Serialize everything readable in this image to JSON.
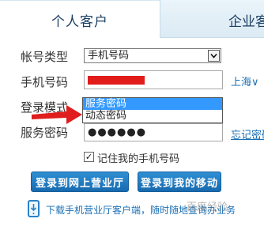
{
  "tabs": {
    "personal": "个人客户",
    "enterprise": "企业客"
  },
  "form": {
    "account_type_label": "帐号类型",
    "account_type_value": "手机号码",
    "phone_label": "手机号码",
    "region_link": "上海∨",
    "login_mode_label": "登录模式",
    "password_label": "服务密码",
    "password_mask": "●●●●●●",
    "forgot_link": "忘记密码",
    "remember_label": "记住我的手机号码",
    "remember_checked": "✓"
  },
  "login_mode_dropdown": {
    "options": [
      "服务密码",
      "动态密码"
    ],
    "selected_index": 0
  },
  "buttons": {
    "login_hall": "登录到网上营业厅",
    "login_mobile": "登录到我的移动"
  },
  "download": {
    "text": "下载手机营业厅客户端，随时随地查询办业务"
  },
  "watermark": "百度经验",
  "colors": {
    "accent": "#1a6fb5",
    "button": "#1f78be",
    "selection": "#3399ff",
    "redaction": "#e21b1b",
    "arrow": "#e01e1e"
  }
}
